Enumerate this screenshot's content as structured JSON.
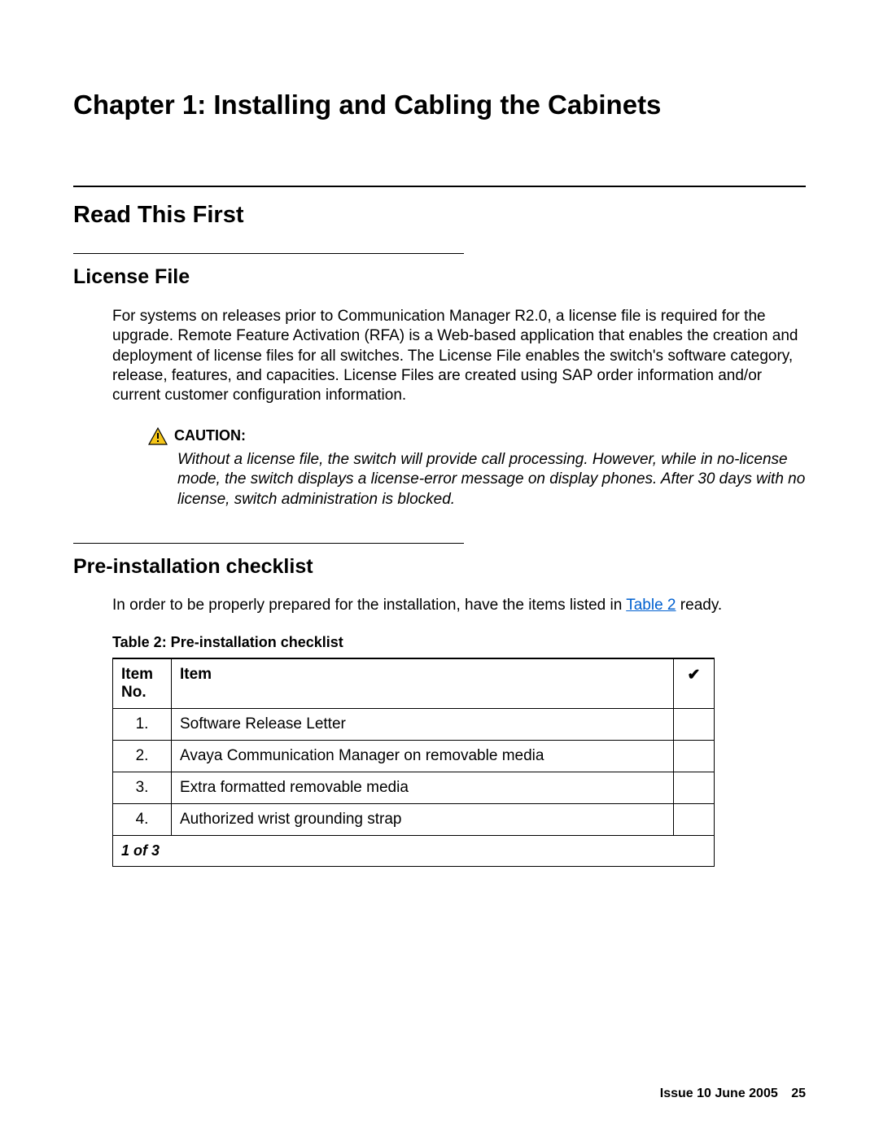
{
  "chapter_title": "Chapter 1:   Installing and Cabling the Cabinets",
  "section1": {
    "title": "Read This First"
  },
  "license": {
    "title": "License File",
    "body": "For systems on releases prior to Communication Manager R2.0, a license file is required for the upgrade. Remote Feature Activation (RFA) is a Web-based application that enables the creation and deployment of license files for all switches. The License File enables the switch's software category, release, features, and capacities. License Files are created using SAP order information and/or current customer configuration information."
  },
  "caution": {
    "label": "CAUTION:",
    "text": "Without a license file, the switch will provide call processing. However, while in no-license mode, the switch displays a license-error message on display phones. After 30 days with no license, switch administration is blocked."
  },
  "preinstall": {
    "title": "Pre-installation checklist",
    "intro_prefix": "In order to be properly prepared for the installation, have the items listed in ",
    "intro_link": "Table 2",
    "intro_suffix": " ready.",
    "table_caption": "Table 2: Pre-installation checklist",
    "headers": {
      "no": "Item No.",
      "item": "Item",
      "check": "✔"
    },
    "rows": [
      {
        "no": "1.",
        "item": "Software Release Letter"
      },
      {
        "no": "2.",
        "item": "Avaya Communication Manager on removable media"
      },
      {
        "no": "3.",
        "item": "Extra formatted removable media"
      },
      {
        "no": "4.",
        "item": "Authorized wrist grounding strap"
      }
    ],
    "page_of": "1 of 3"
  },
  "footer": {
    "issue": "Issue 10    June 2005",
    "page": "25"
  }
}
